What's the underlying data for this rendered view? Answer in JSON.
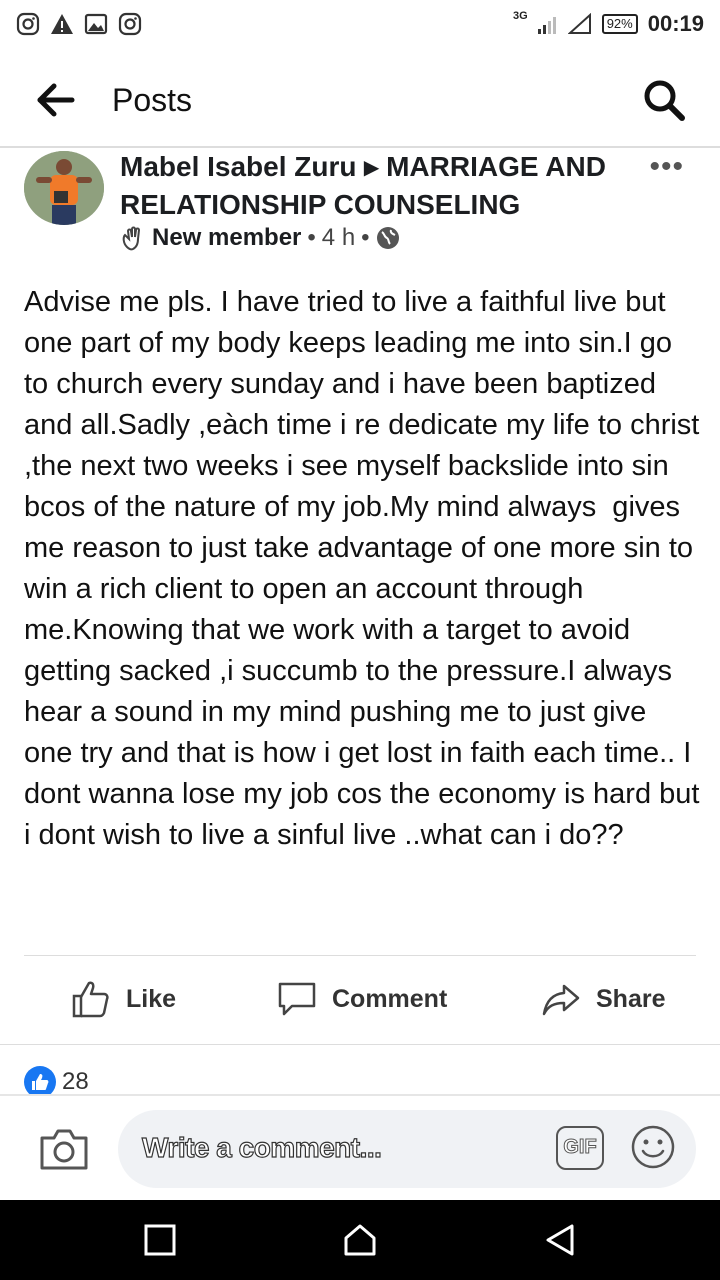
{
  "status_bar": {
    "network": "3G",
    "battery": "92%",
    "time": "00:19",
    "left_icons": [
      "instagram-icon",
      "alert-icon",
      "image-icon",
      "instagram-icon"
    ]
  },
  "header": {
    "title": "Posts",
    "back_icon": "arrow-left-icon",
    "search_icon": "search-icon"
  },
  "post": {
    "author_line": "Mabel Isabel Zuru ▸ MARRIAGE AND RELATIONSHIP COUNSELING",
    "badge": "New member",
    "sep1": "•",
    "time": "4 h",
    "sep2": "•",
    "more": "•••",
    "body": "Advise me pls. I have tried to live a faithful live but one part of my body keeps leading me into sin.I go to church every sunday and i have been baptized and all.Sadly ,eàch time i re dedicate my life to christ ,the next two weeks i see myself backslide into sin bcos of the nature of my job.My mind always  gives me reason to just take advantage of one more sin to win a rich client to open an account through me.Knowing that we work with a target to avoid getting sacked ,i succumb to the pressure.I always hear a sound in my mind pushing me to just give one try and that is how i get lost in faith each time.. I dont wanna lose my job cos the economy is hard but i dont wish to live a sinful live ..what can i do??"
  },
  "actions": {
    "like": "Like",
    "comment": "Comment",
    "share": "Share"
  },
  "reactions": {
    "count": "28"
  },
  "comment_bar": {
    "placeholder": "Write a comment...",
    "gif": "GIF"
  },
  "colors": {
    "accent": "#1877f2",
    "navbar": "#000000"
  }
}
